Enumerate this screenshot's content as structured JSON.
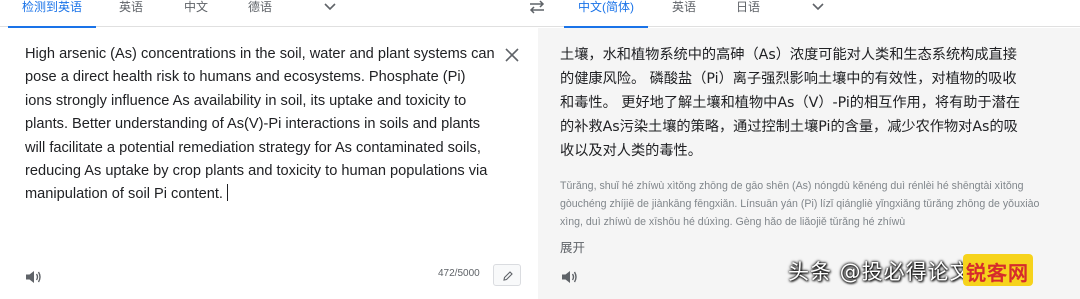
{
  "source_langs": {
    "tabs": [
      "检测到英语",
      "英语",
      "中文",
      "德语"
    ],
    "active_index": 0
  },
  "target_langs": {
    "tabs": [
      "中文(简体)",
      "英语",
      "日语"
    ],
    "active_index": 0
  },
  "icons": {
    "swap": "swap-languages-icon",
    "more_source": "chevron-down-icon",
    "more_target": "chevron-down-icon",
    "clear": "close-icon",
    "listen_source": "speaker-icon",
    "listen_target": "speaker-icon",
    "edit": "pencil-icon"
  },
  "source": {
    "text": "High arsenic (As) concentrations in the soil, water and plant systems can pose a direct health risk to humans and ecosystems. Phosphate (Pi) ions strongly influence As availability in soil, its uptake and toxicity to plants. Better understanding of As(V)-Pi interactions in soils and plants will facilitate a potential remediation strategy for As contaminated soils, reducing As uptake by crop plants and toxicity to human populations via manipulation of soil Pi content.",
    "char_count": "472/5000"
  },
  "target": {
    "text": "土壤，水和植物系统中的高砷（As）浓度可能对人类和生态系统构成直接的健康风险。 磷酸盐（Pi）离子强烈影响土壤中的有效性，对植物的吸收和毒性。 更好地了解土壤和植物中As（V）-Pi的相互作用，将有助于潜在的补救As污染土壤的策略，通过控制土壤Pi的含量，减少农作物对As的吸收以及对人类的毒性。",
    "romanization": "Tǔrǎng, shuǐ hé zhíwù xìtǒng zhōng de gāo shēn (As) nóngdù kěnéng duì rénlèi hé shēngtài xìtǒng gòuchéng zhíjiē de jiànkāng fēngxiǎn. Línsuān yán (Pi) lízǐ qiángliè yǐngxiǎng tǔrǎng zhōng de yǒuxiào xìng, duì zhíwù de xīshōu hé dúxìng. Gèng hǎo de liǎojiě tǔrǎng hé zhíwù",
    "expand_label": "展开"
  },
  "watermark": {
    "text": "头条 @投必得论文编译",
    "badge": "锐客网"
  },
  "colors": {
    "accent": "#1a73e8",
    "right_pane_bg": "#f5f5f5",
    "badge_bg": "#f6d31c",
    "badge_text": "#d62c2c"
  }
}
